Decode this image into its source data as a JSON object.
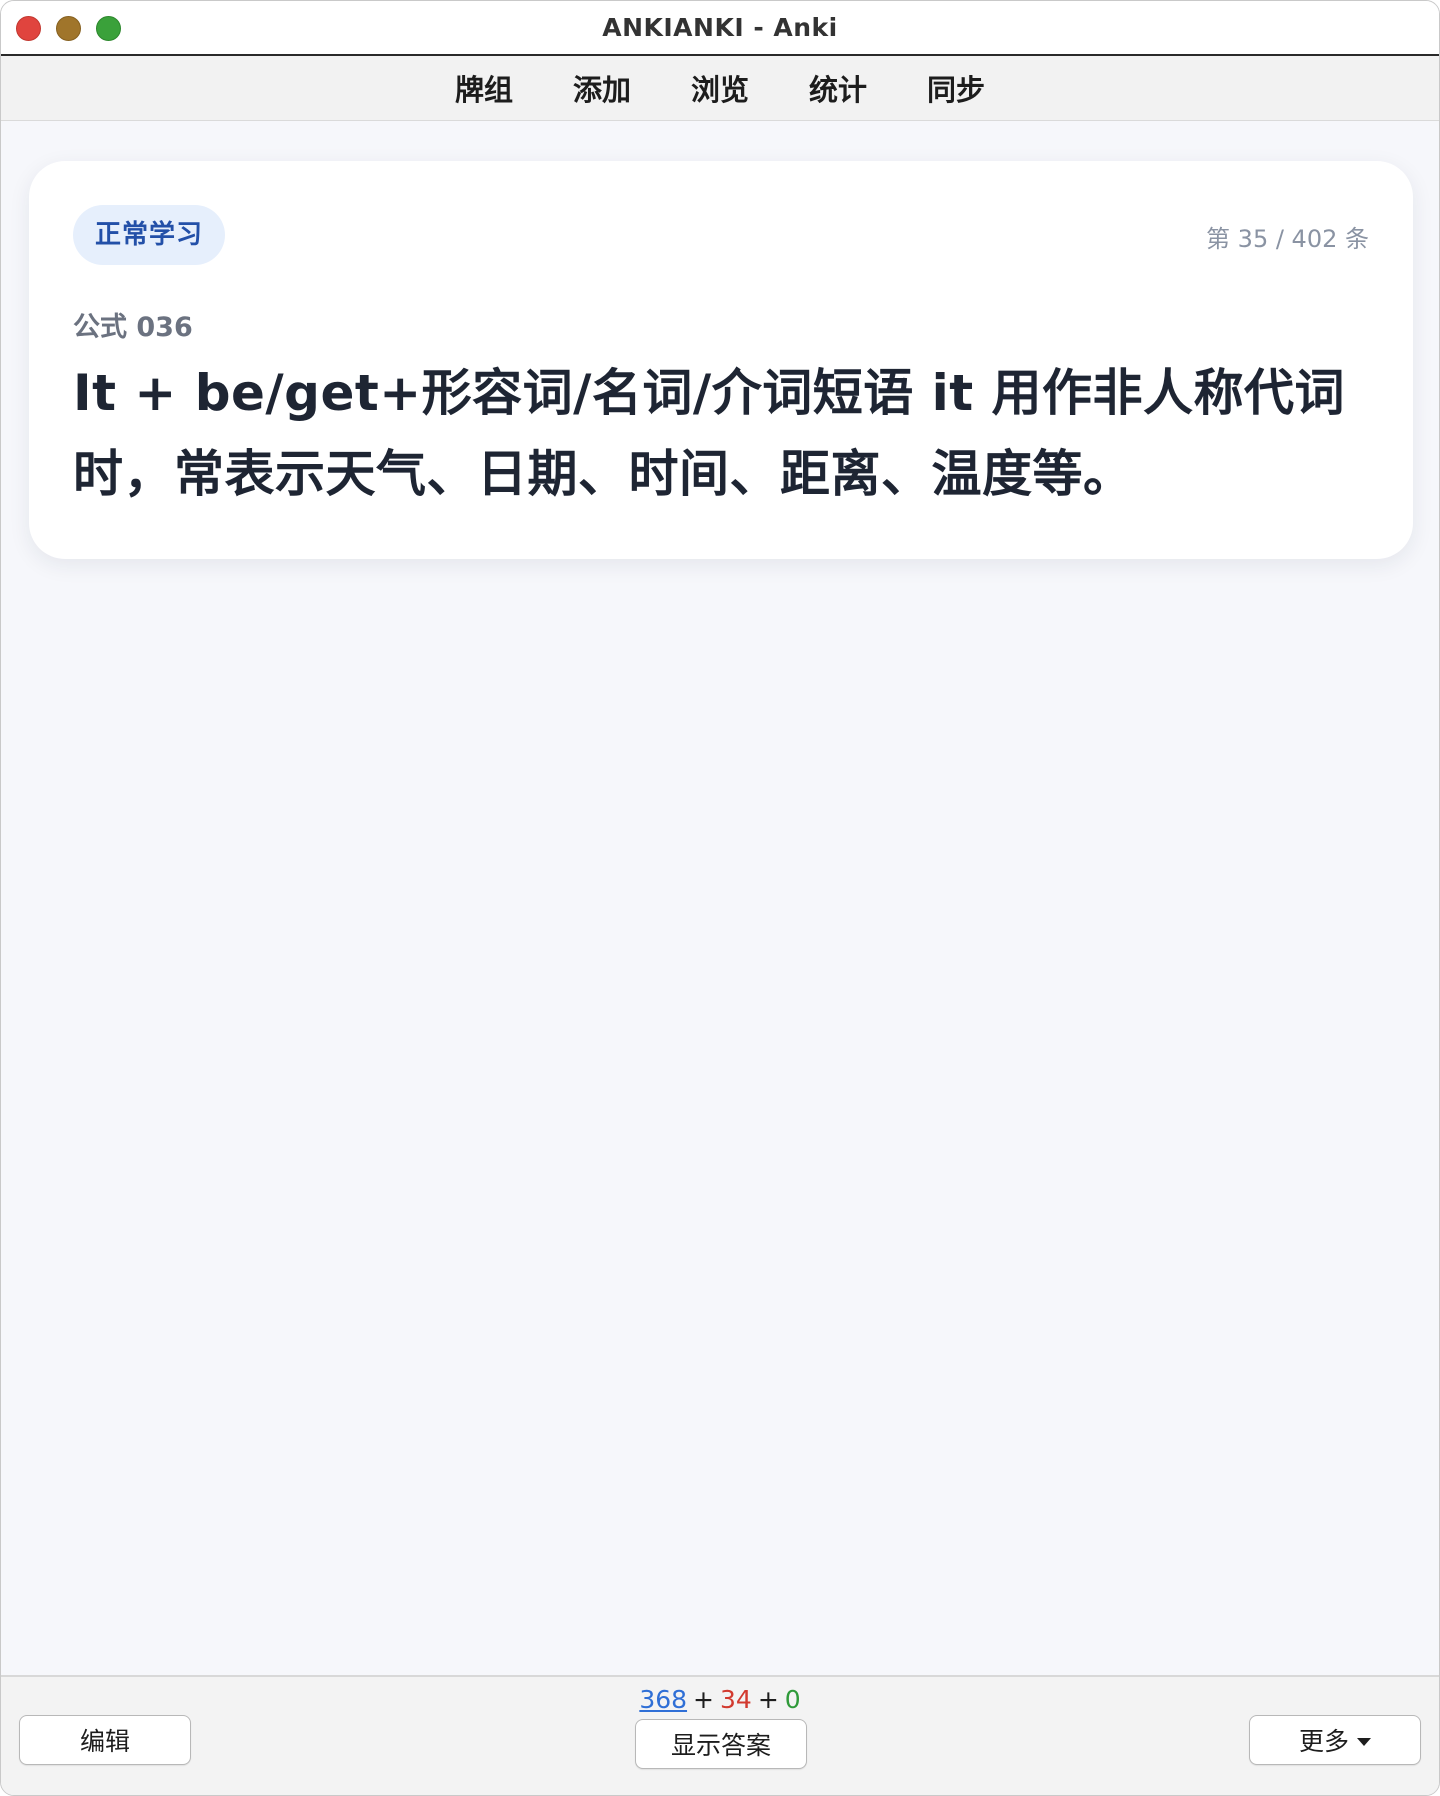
{
  "window": {
    "title": "ANKIANKI - Anki"
  },
  "menu": {
    "items": [
      "牌组",
      "添加",
      "浏览",
      "统计",
      "同步"
    ]
  },
  "card": {
    "badge": "正常学习",
    "counter": "第 35 / 402 条",
    "label": "公式 036",
    "text": "It + be/get+形容词/名词/介词短语 it 用作非人称代词时，常表示天气、日期、时间、距离、温度等。"
  },
  "bottom": {
    "edit_label": "编辑",
    "show_answer_label": "显示答案",
    "more_label": "更多",
    "counts": {
      "new": "368",
      "learn": "34",
      "review": "0",
      "plus": "+"
    }
  },
  "colors": {
    "new_count": "#2f6fd6",
    "learn_count": "#d23a2f",
    "review_count": "#2f9a3a",
    "badge_bg": "#e6effc",
    "badge_text": "#2350a8"
  }
}
